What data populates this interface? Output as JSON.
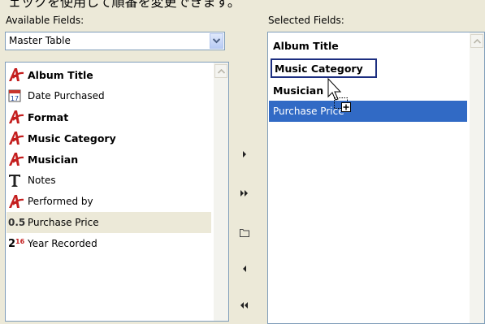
{
  "top_strip_text": "ェックを使用して順番を変更できます。",
  "available": {
    "label": "Available Fields:",
    "source_combo": "Master Table",
    "items": [
      {
        "label": "Album Title",
        "bold": true,
        "icon": "letter-a-icon"
      },
      {
        "label": "Date Purchased",
        "bold": false,
        "icon": "calendar-icon"
      },
      {
        "label": "Format",
        "bold": true,
        "icon": "letter-a-icon"
      },
      {
        "label": "Music Category",
        "bold": true,
        "icon": "letter-a-icon"
      },
      {
        "label": "Musician",
        "bold": true,
        "icon": "letter-a-icon"
      },
      {
        "label": "Notes",
        "bold": false,
        "icon": "text-t-icon"
      },
      {
        "label": "Performed by",
        "bold": false,
        "icon": "letter-a-icon"
      },
      {
        "label": "Purchase Price",
        "bold": false,
        "icon": "decimal-number-icon",
        "icon_text": "0.5",
        "selected": true
      },
      {
        "label": "Year Recorded",
        "bold": false,
        "icon": "integer-number-icon",
        "icon_text": "2",
        "icon_sup": "16"
      }
    ]
  },
  "selected": {
    "label": "Selected Fields:",
    "items": [
      {
        "label": "Album Title"
      },
      {
        "label": "Music Category"
      },
      {
        "label": "Musician"
      },
      {
        "label": "Purchase Price"
      }
    ]
  },
  "colors": {
    "icon_red": "#c41e1e",
    "highlight": "#316ac5",
    "dark_blue_border": "#1c2e80",
    "window_bg": "#ece9d8"
  }
}
